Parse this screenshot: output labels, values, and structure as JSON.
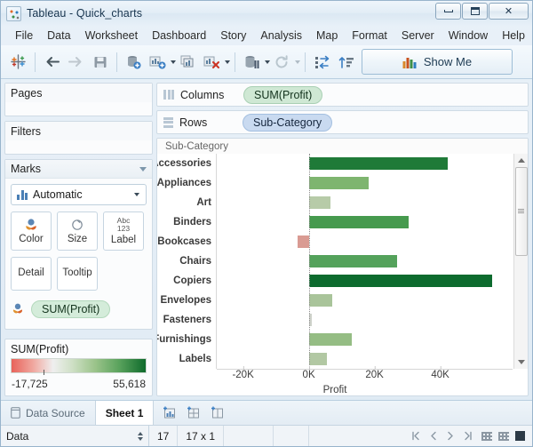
{
  "window": {
    "title": "Tableau - Quick_charts",
    "app_icon": "tableau-icon",
    "buttons": [
      {
        "name": "minimize-button",
        "glyph": "minimize-icon"
      },
      {
        "name": "maximize-button",
        "glyph": "maximize-icon"
      },
      {
        "name": "close-button",
        "glyph": "close-icon",
        "label": "✕"
      }
    ]
  },
  "menu": {
    "items": [
      "File",
      "Data",
      "Worksheet",
      "Dashboard",
      "Story",
      "Analysis",
      "Map",
      "Format",
      "Server",
      "Window",
      "Help"
    ]
  },
  "toolbar": {
    "buttons": [
      {
        "name": "tableau-home-button",
        "icon": "tableau-logo-icon"
      },
      {
        "name": "back-button",
        "icon": "arrow-left-icon"
      },
      {
        "name": "forward-button",
        "icon": "arrow-right-icon"
      },
      {
        "name": "save-button",
        "icon": "floppy-disk-icon"
      },
      {
        "name": "connect-data-button",
        "icon": "database-add-icon"
      },
      {
        "name": "new-worksheet-button",
        "icon": "new-worksheet-icon"
      },
      {
        "name": "duplicate-sheet-button",
        "icon": "duplicate-sheet-icon"
      },
      {
        "name": "clear-sheet-button",
        "icon": "clear-sheet-icon"
      },
      {
        "name": "pause-updates-button",
        "icon": "pause-updates-icon"
      },
      {
        "name": "refresh-button",
        "icon": "refresh-icon"
      },
      {
        "name": "swap-rows-columns-button",
        "icon": "swap-axis-icon"
      },
      {
        "name": "sort-ascending-button",
        "icon": "sort-ascending-icon"
      }
    ],
    "show_me_label": "Show Me"
  },
  "sidebar": {
    "pages": {
      "title": "Pages"
    },
    "filters": {
      "title": "Filters"
    },
    "marks": {
      "title": "Marks",
      "mark_type": "Automatic",
      "buttons": [
        {
          "name": "color-button",
          "label": "Color",
          "icon": "color-palette-icon"
        },
        {
          "name": "size-button",
          "label": "Size",
          "icon": "size-circle-icon"
        },
        {
          "name": "label-button",
          "label": "Label",
          "icon": "abc-123-icon",
          "icon_text_top": "Abc",
          "icon_text_bottom": "123"
        },
        {
          "name": "detail-button",
          "label": "Detail",
          "icon": "detail-icon"
        },
        {
          "name": "tooltip-button",
          "label": "Tooltip",
          "icon": "tooltip-icon"
        }
      ],
      "color_pill": "SUM(Profit)"
    },
    "legend": {
      "title": "SUM(Profit)",
      "min": "-17,725",
      "max": "55,618",
      "ramp_low_color": "#e8635a",
      "ramp_mid_color": "#efefef",
      "ramp_high_color": "#0f6b2c"
    }
  },
  "shelves": {
    "columns": {
      "label": "Columns",
      "pill": "SUM(Profit)",
      "pill_color": "green"
    },
    "rows": {
      "label": "Rows",
      "pill": "Sub-Category",
      "pill_color": "blue"
    }
  },
  "viz": {
    "row_field_header": "Sub-Category"
  },
  "chart_data": {
    "type": "bar",
    "orientation": "horizontal",
    "title": "",
    "xlabel": "Profit",
    "ylabel": "Sub-Category",
    "xlim": [
      -28000,
      62000
    ],
    "xticks": [
      -20000,
      0,
      20000,
      40000
    ],
    "xticklabels": [
      "-20K",
      "0K",
      "20K",
      "40K"
    ],
    "grid": false,
    "legend": "SUM(Profit) color gradient",
    "categories": [
      "Accessories",
      "Appliances",
      "Art",
      "Binders",
      "Bookcases",
      "Chairs",
      "Copiers",
      "Envelopes",
      "Fasteners",
      "Furnishings",
      "Labels"
    ],
    "values": [
      41937,
      18138,
      6528,
      30222,
      -3473,
      26590,
      55618,
      6964,
      950,
      13059,
      5546
    ],
    "colors": [
      "#1f7a38",
      "#7eb56f",
      "#b7cba8",
      "#469a4e",
      "#d99b93",
      "#54a25b",
      "#0d6b2e",
      "#a9c49a",
      "#cfd3cb",
      "#95bd84",
      "#b2c8a3"
    ]
  },
  "tabs": {
    "data_source": "Data Source",
    "sheet": "Sheet 1",
    "icons": [
      {
        "name": "new-worksheet-tab-icon"
      },
      {
        "name": "new-dashboard-tab-icon"
      },
      {
        "name": "new-story-tab-icon"
      }
    ]
  },
  "statusbar": {
    "data_label": "Data",
    "marks_count": "17",
    "dimensions": "17 x 1",
    "nav": [
      "first-page-icon",
      "previous-page-icon",
      "next-page-icon",
      "last-page-icon"
    ]
  }
}
